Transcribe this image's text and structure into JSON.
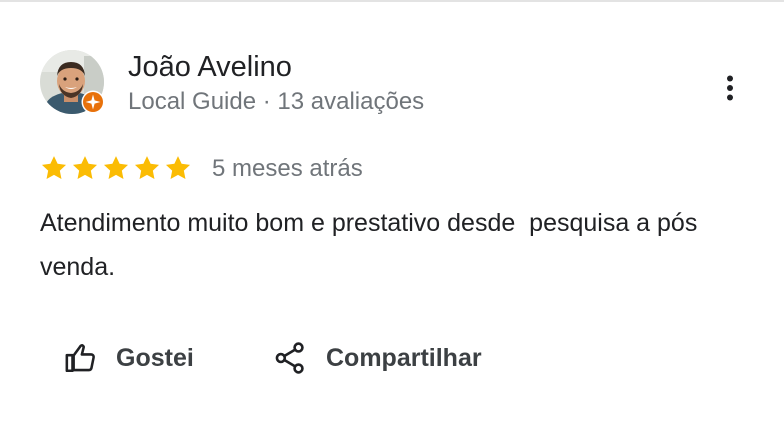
{
  "review": {
    "author": {
      "name": "João Avelino",
      "meta": "Local Guide · 13 avaliações",
      "avatar_icon": "user-photo",
      "badge_icon": "local-guide-star-badge",
      "badge_color": "#e8710a"
    },
    "rating": 5,
    "rating_max": 5,
    "star_color": "#fbbc04",
    "date": "5 meses atrás",
    "text": "Atendimento muito bom e prestativo desde  pesquisa a pós venda.",
    "actions": {
      "like_label": "Gostei",
      "like_icon": "thumbs-up-icon",
      "share_label": "Compartilhar",
      "share_icon": "share-icon"
    },
    "more_icon": "more-vert-icon"
  }
}
